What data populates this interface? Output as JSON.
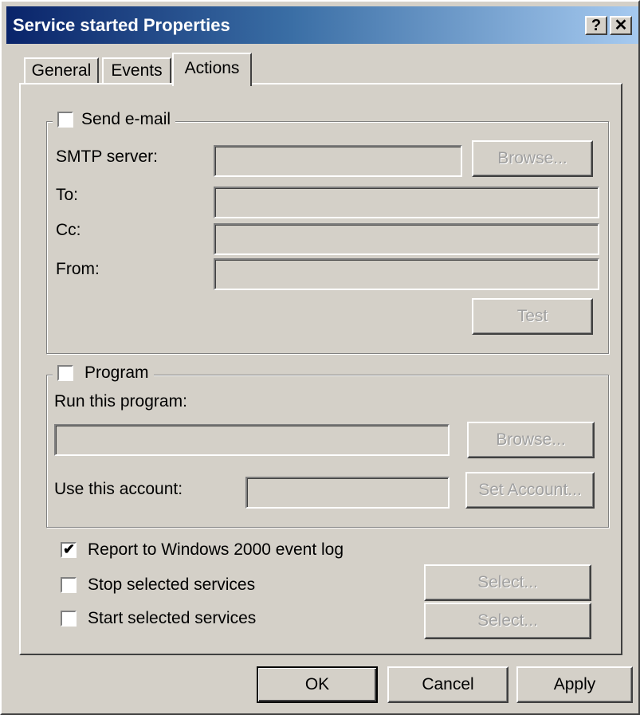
{
  "window": {
    "title": "Service started Properties",
    "help_button": "?",
    "close_button": "✕"
  },
  "tabs": [
    {
      "label": "General",
      "active": false
    },
    {
      "label": "Events",
      "active": false
    },
    {
      "label": "Actions",
      "active": true
    }
  ],
  "email": {
    "checkbox_label": "Send e-mail",
    "checked": false,
    "smtp_label": "SMTP server:",
    "smtp_value": "",
    "browse_label": "Browse...",
    "to_label": "To:",
    "to_value": "",
    "cc_label": "Cc:",
    "cc_value": "",
    "from_label": "From:",
    "from_value": "",
    "test_label": "Test"
  },
  "program": {
    "checkbox_label": "Program",
    "checked": false,
    "run_label": "Run this program:",
    "run_value": "",
    "browse_label": "Browse...",
    "account_label": "Use this account:",
    "account_value": "",
    "set_account_label": "Set Account..."
  },
  "options": {
    "report_label": "Report to Windows 2000 event log",
    "report_checked": true,
    "stop_label": "Stop selected services",
    "stop_checked": false,
    "start_label": "Start selected services",
    "start_checked": false,
    "select_label_1": "Select...",
    "select_label_2": "Select..."
  },
  "footer": {
    "ok_label": "OK",
    "cancel_label": "Cancel",
    "apply_label": "Apply"
  }
}
